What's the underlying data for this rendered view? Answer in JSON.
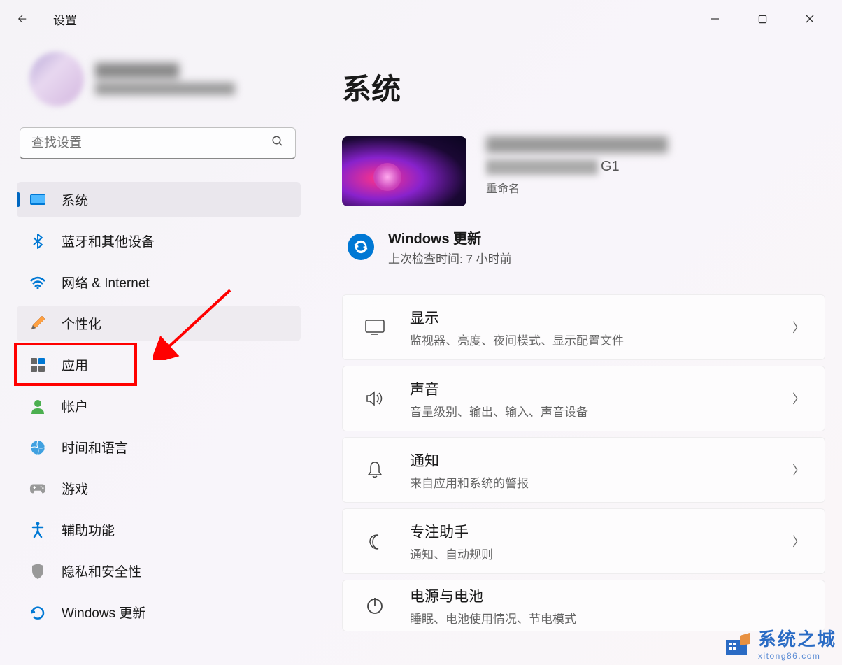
{
  "window": {
    "title": "设置"
  },
  "search": {
    "placeholder": "查找设置"
  },
  "nav": {
    "system": "系统",
    "bluetooth": "蓝牙和其他设备",
    "network": "网络 & Internet",
    "personalization": "个性化",
    "apps": "应用",
    "accounts": "帐户",
    "time": "时间和语言",
    "gaming": "游戏",
    "accessibility": "辅助功能",
    "privacy": "隐私和安全性",
    "update": "Windows 更新"
  },
  "page": {
    "title": "系统",
    "device_suffix": "G1",
    "rename": "重命名"
  },
  "windows_update": {
    "title": "Windows 更新",
    "subtitle": "上次检查时间: 7 小时前"
  },
  "cards": {
    "display": {
      "title": "显示",
      "sub": "监视器、亮度、夜间模式、显示配置文件"
    },
    "sound": {
      "title": "声音",
      "sub": "音量级别、输出、输入、声音设备"
    },
    "notifications": {
      "title": "通知",
      "sub": "来自应用和系统的警报"
    },
    "focus": {
      "title": "专注助手",
      "sub": "通知、自动规则"
    },
    "power": {
      "title": "电源与电池",
      "sub": "睡眠、电池使用情况、节电模式"
    }
  },
  "watermark": {
    "main": "系统之城",
    "sub": "xitong86.com"
  }
}
